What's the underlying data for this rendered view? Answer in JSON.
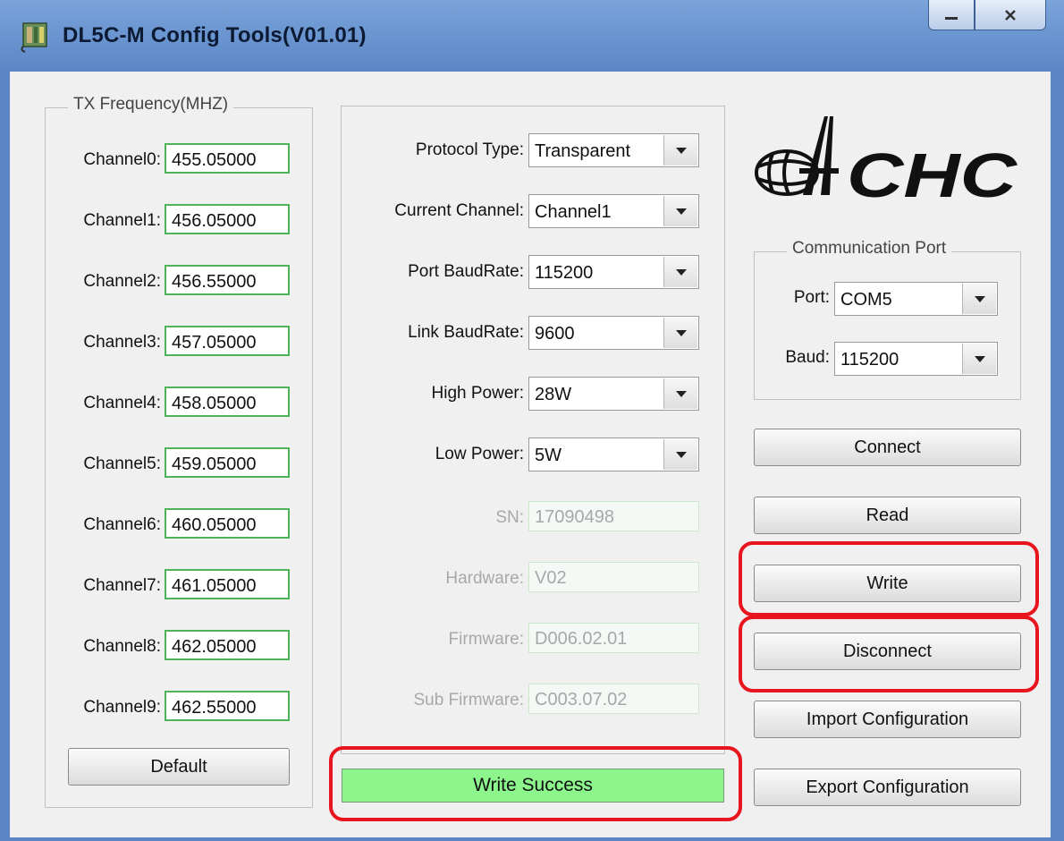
{
  "window": {
    "title": "DL5C-M Config Tools(V01.01)",
    "icons": [
      "app-icon",
      "minimize-icon",
      "close-icon"
    ],
    "accent_color": "#5b87c6"
  },
  "tx_frequency": {
    "legend": "TX Frequency(MHZ)",
    "channels": [
      {
        "label": "Channel0:",
        "value": "455.05000"
      },
      {
        "label": "Channel1:",
        "value": "456.05000"
      },
      {
        "label": "Channel2:",
        "value": "456.55000"
      },
      {
        "label": "Channel3:",
        "value": "457.05000"
      },
      {
        "label": "Channel4:",
        "value": "458.05000"
      },
      {
        "label": "Channel5:",
        "value": "459.05000"
      },
      {
        "label": "Channel6:",
        "value": "460.05000"
      },
      {
        "label": "Channel7:",
        "value": "461.05000"
      },
      {
        "label": "Channel8:",
        "value": "462.05000"
      },
      {
        "label": "Channel9:",
        "value": "462.55000"
      }
    ],
    "default_label": "Default"
  },
  "settings": {
    "protocol_type": {
      "label": "Protocol Type:",
      "value": "Transparent"
    },
    "current_channel": {
      "label": "Current Channel:",
      "value": "Channel1"
    },
    "port_baudrate": {
      "label": "Port BaudRate:",
      "value": "115200"
    },
    "link_baudrate": {
      "label": "Link BaudRate:",
      "value": "9600"
    },
    "high_power": {
      "label": "High Power:",
      "value": "28W"
    },
    "low_power": {
      "label": "Low Power:",
      "value": "5W"
    },
    "sn": {
      "label": "SN:",
      "value": "17090498"
    },
    "hardware": {
      "label": "Hardware:",
      "value": "V02"
    },
    "firmware": {
      "label": "Firmware:",
      "value": "D006.02.01"
    },
    "sub_firmware": {
      "label": "Sub Firmware:",
      "value": "C003.07.02"
    }
  },
  "status": {
    "text": "Write Success",
    "color": "#8cf58c"
  },
  "logo": {
    "text": "CHC"
  },
  "comm_port": {
    "legend": "Communication Port",
    "port": {
      "label": "Port:",
      "value": "COM5"
    },
    "baud": {
      "label": "Baud:",
      "value": "115200"
    }
  },
  "actions": {
    "connect": "Connect",
    "read": "Read",
    "write": "Write",
    "disconnect": "Disconnect",
    "import": "Import Configuration",
    "export": "Export Configuration"
  },
  "highlight_color": "#e8141e"
}
